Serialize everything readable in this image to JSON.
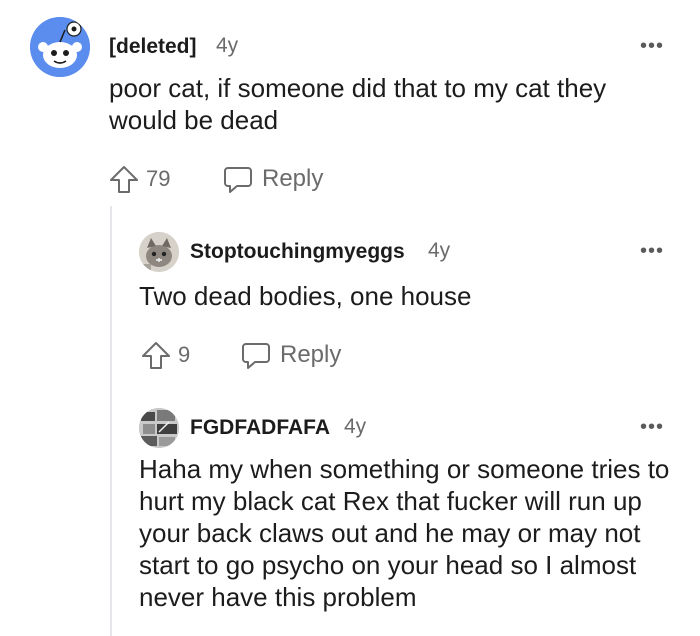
{
  "comments": [
    {
      "username": "[deleted]",
      "age": "4y",
      "body": "poor cat, if someone did that to my cat they would be dead",
      "score": "79",
      "reply_label": "Reply",
      "avatar_icon": "reddit-snoo-icon"
    },
    {
      "username": "Stoptouchingmyeggs",
      "age": "4y",
      "body": "Two dead bodies, one house",
      "score": "9",
      "reply_label": "Reply",
      "avatar_icon": "cat-photo-avatar"
    },
    {
      "username": "FGDFADFAFA",
      "age": "4y",
      "body": "Haha my when something or someone tries to hurt my black cat Rex that fucker will run up your back claws out and he may or may not start to go psycho on your head so I almost never have this problem",
      "avatar_icon": "photo-avatar"
    }
  ],
  "more_label": "•••",
  "colors": {
    "text": "#1c1c1c",
    "muted": "#6b6b6b",
    "thread_line": "#e5e7eb",
    "snoo_blue": "#5b8def"
  }
}
